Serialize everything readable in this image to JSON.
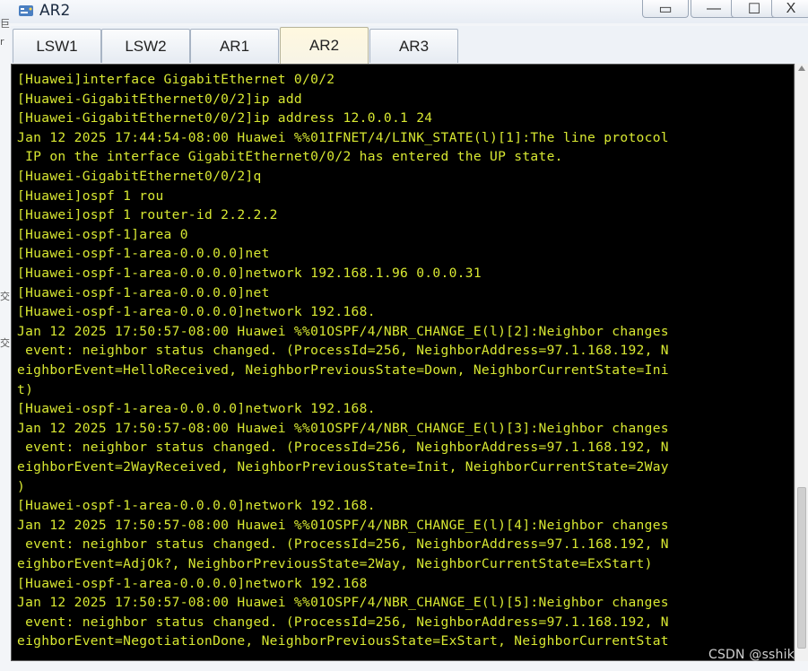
{
  "window": {
    "title": "AR2",
    "controls": {
      "restore": "▭",
      "minimize": "—",
      "maximize": "☐",
      "close": "X"
    }
  },
  "left_strip": [
    "巨",
    "r",
    "交",
    "交"
  ],
  "tabs": [
    {
      "label": "LSW1",
      "active": false
    },
    {
      "label": "LSW2",
      "active": false
    },
    {
      "label": "AR1",
      "active": false
    },
    {
      "label": "AR2",
      "active": true
    },
    {
      "label": "AR3",
      "active": false
    }
  ],
  "console": {
    "lines": [
      "[Huawei]interface GigabitEthernet 0/0/2",
      "[Huawei-GigabitEthernet0/0/2]ip add",
      "[Huawei-GigabitEthernet0/0/2]ip address 12.0.0.1 24",
      "Jan 12 2025 17:44:54-08:00 Huawei %%01IFNET/4/LINK_STATE(l)[1]:The line protocol",
      " IP on the interface GigabitEthernet0/0/2 has entered the UP state.",
      "[Huawei-GigabitEthernet0/0/2]q",
      "[Huawei]ospf 1 rou",
      "[Huawei]ospf 1 router-id 2.2.2.2",
      "[Huawei-ospf-1]area 0",
      "[Huawei-ospf-1-area-0.0.0.0]net",
      "[Huawei-ospf-1-area-0.0.0.0]network 192.168.1.96 0.0.0.31",
      "[Huawei-ospf-1-area-0.0.0.0]net",
      "[Huawei-ospf-1-area-0.0.0.0]network 192.168.",
      "Jan 12 2025 17:50:57-08:00 Huawei %%01OSPF/4/NBR_CHANGE_E(l)[2]:Neighbor changes",
      " event: neighbor status changed. (ProcessId=256, NeighborAddress=97.1.168.192, N",
      "eighborEvent=HelloReceived, NeighborPreviousState=Down, NeighborCurrentState=Ini",
      "t)",
      "[Huawei-ospf-1-area-0.0.0.0]network 192.168.",
      "Jan 12 2025 17:50:57-08:00 Huawei %%01OSPF/4/NBR_CHANGE_E(l)[3]:Neighbor changes",
      " event: neighbor status changed. (ProcessId=256, NeighborAddress=97.1.168.192, N",
      "eighborEvent=2WayReceived, NeighborPreviousState=Init, NeighborCurrentState=2Way",
      ")",
      "[Huawei-ospf-1-area-0.0.0.0]network 192.168.",
      "Jan 12 2025 17:50:57-08:00 Huawei %%01OSPF/4/NBR_CHANGE_E(l)[4]:Neighbor changes",
      " event: neighbor status changed. (ProcessId=256, NeighborAddress=97.1.168.192, N",
      "eighborEvent=AdjOk?, NeighborPreviousState=2Way, NeighborCurrentState=ExStart)",
      "[Huawei-ospf-1-area-0.0.0.0]network 192.168",
      "Jan 12 2025 17:50:57-08:00 Huawei %%01OSPF/4/NBR_CHANGE_E(l)[5]:Neighbor changes",
      " event: neighbor status changed. (ProcessId=256, NeighborAddress=97.1.168.192, N",
      "eighborEvent=NegotiationDone, NeighborPreviousState=ExStart, NeighborCurrentStat"
    ]
  },
  "watermark": "CSDN @sshik"
}
